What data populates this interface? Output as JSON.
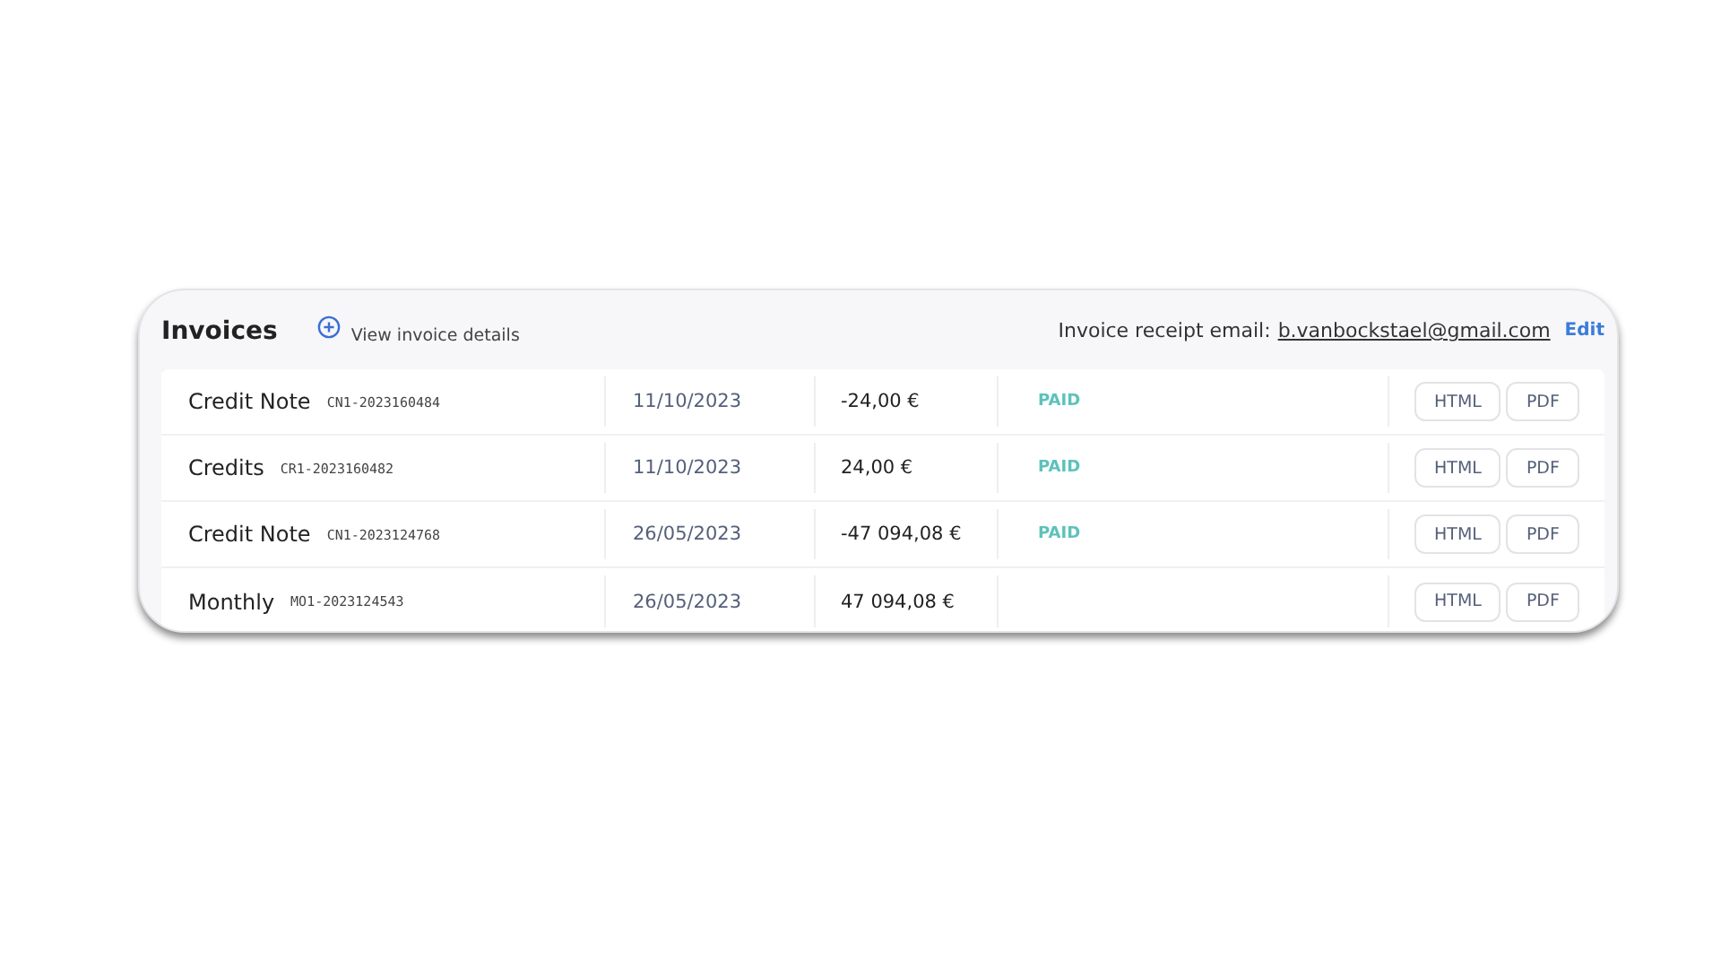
{
  "title": "Invoices",
  "details_link": "View invoice details",
  "receipt": {
    "label": "Invoice receipt email:",
    "email": "b.vanbockstael@gmail.com",
    "edit": "Edit"
  },
  "invoices": [
    {
      "type": "Credit Note",
      "number": "CN1-2023160484",
      "date": "11/10/2023",
      "amount": "-24,00 €",
      "status": "PAID",
      "buttons": [
        "HTML",
        "PDF"
      ]
    },
    {
      "type": "Credits",
      "number": "CR1-2023160482",
      "date": "11/10/2023",
      "amount": "24,00 €",
      "status": "PAID",
      "buttons": [
        "HTML",
        "PDF"
      ]
    },
    {
      "type": "Credit Note",
      "number": "CN1-2023124768",
      "date": "26/05/2023",
      "amount": "-47 094,08 €",
      "status": "PAID",
      "buttons": [
        "HTML",
        "PDF"
      ]
    },
    {
      "type": "Monthly",
      "number": "MO1-2023124543",
      "date": "26/05/2023",
      "amount": "47 094,08 €",
      "buttons": [
        "HTML",
        "PDF"
      ]
    }
  ]
}
